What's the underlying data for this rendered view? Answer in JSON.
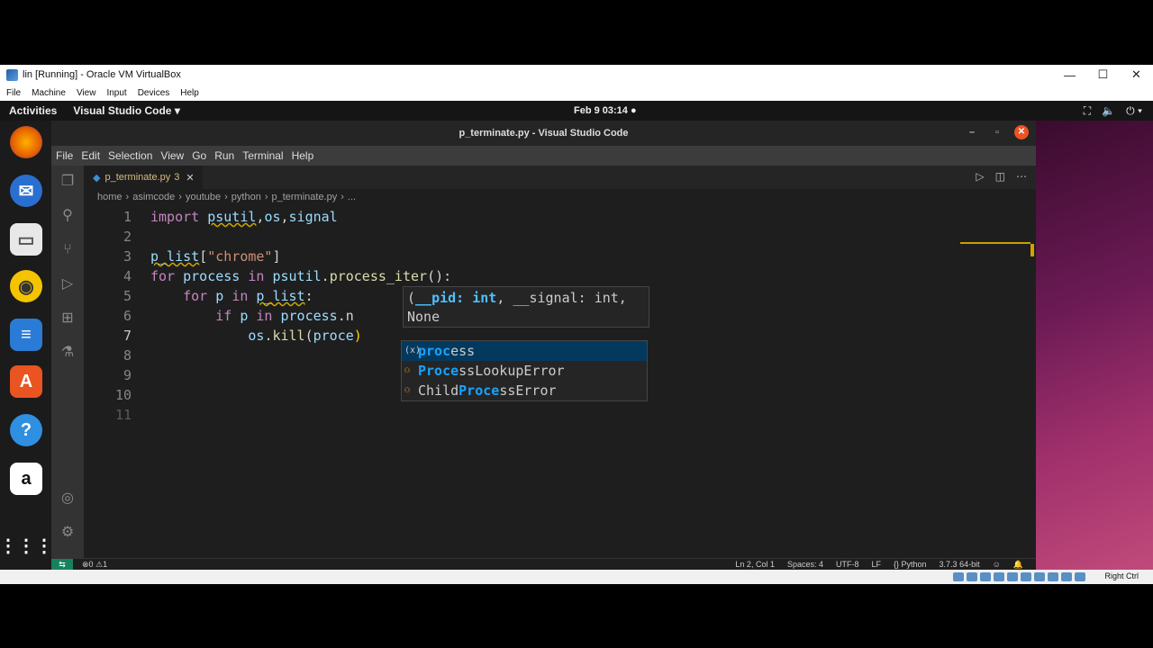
{
  "vbox": {
    "title": "lin [Running] - Oracle VM VirtualBox",
    "menu": [
      "File",
      "Machine",
      "View",
      "Input",
      "Devices",
      "Help"
    ],
    "minimize": "—",
    "maximize": "☐",
    "close": "✕",
    "host_key": "Right Ctrl"
  },
  "ubuntu": {
    "activities": "Activities",
    "app_name": "Visual Studio Code ▾",
    "clock": "Feb 9  03:14 ●",
    "dock_icons": [
      "firefox-icon",
      "thunderbird-icon",
      "files-icon",
      "rhythmbox-icon",
      "writer-icon",
      "software-icon",
      "help-icon",
      "amazon-icon",
      "apps-grid-icon"
    ]
  },
  "vscode": {
    "title": "p_terminate.py - Visual Studio Code",
    "menu": [
      "File",
      "Edit",
      "Selection",
      "View",
      "Go",
      "Run",
      "Terminal",
      "Help"
    ],
    "tab": {
      "name": "p_terminate.py",
      "badge": "3"
    },
    "breadcrumb": [
      "home",
      "asimcode",
      "youtube",
      "python",
      "p_terminate.py",
      "..."
    ],
    "line_numbers": [
      "1",
      "2",
      "3",
      "4",
      "5",
      "6",
      "7",
      "8",
      "9",
      "10",
      "11"
    ],
    "signature": {
      "params": "__pid: int",
      "rest": ", __signal: int,",
      "returns": "None"
    },
    "suggestions": [
      {
        "match": "proc",
        "rest": "ess",
        "icon": "variable-icon"
      },
      {
        "match": "Proce",
        "rest": "ssLookupError",
        "icon": "class-icon"
      },
      {
        "pre": "Child",
        "match": "Proce",
        "rest": "ssError",
        "icon": "class-icon"
      }
    ],
    "status": {
      "problems": "⊗0 ⚠1",
      "position": "Ln 2, Col 1",
      "spaces": "Spaces: 4",
      "encoding": "UTF-8",
      "eol": "LF",
      "language": "{} Python",
      "interpreter": "3.7.3 64-bit"
    }
  }
}
